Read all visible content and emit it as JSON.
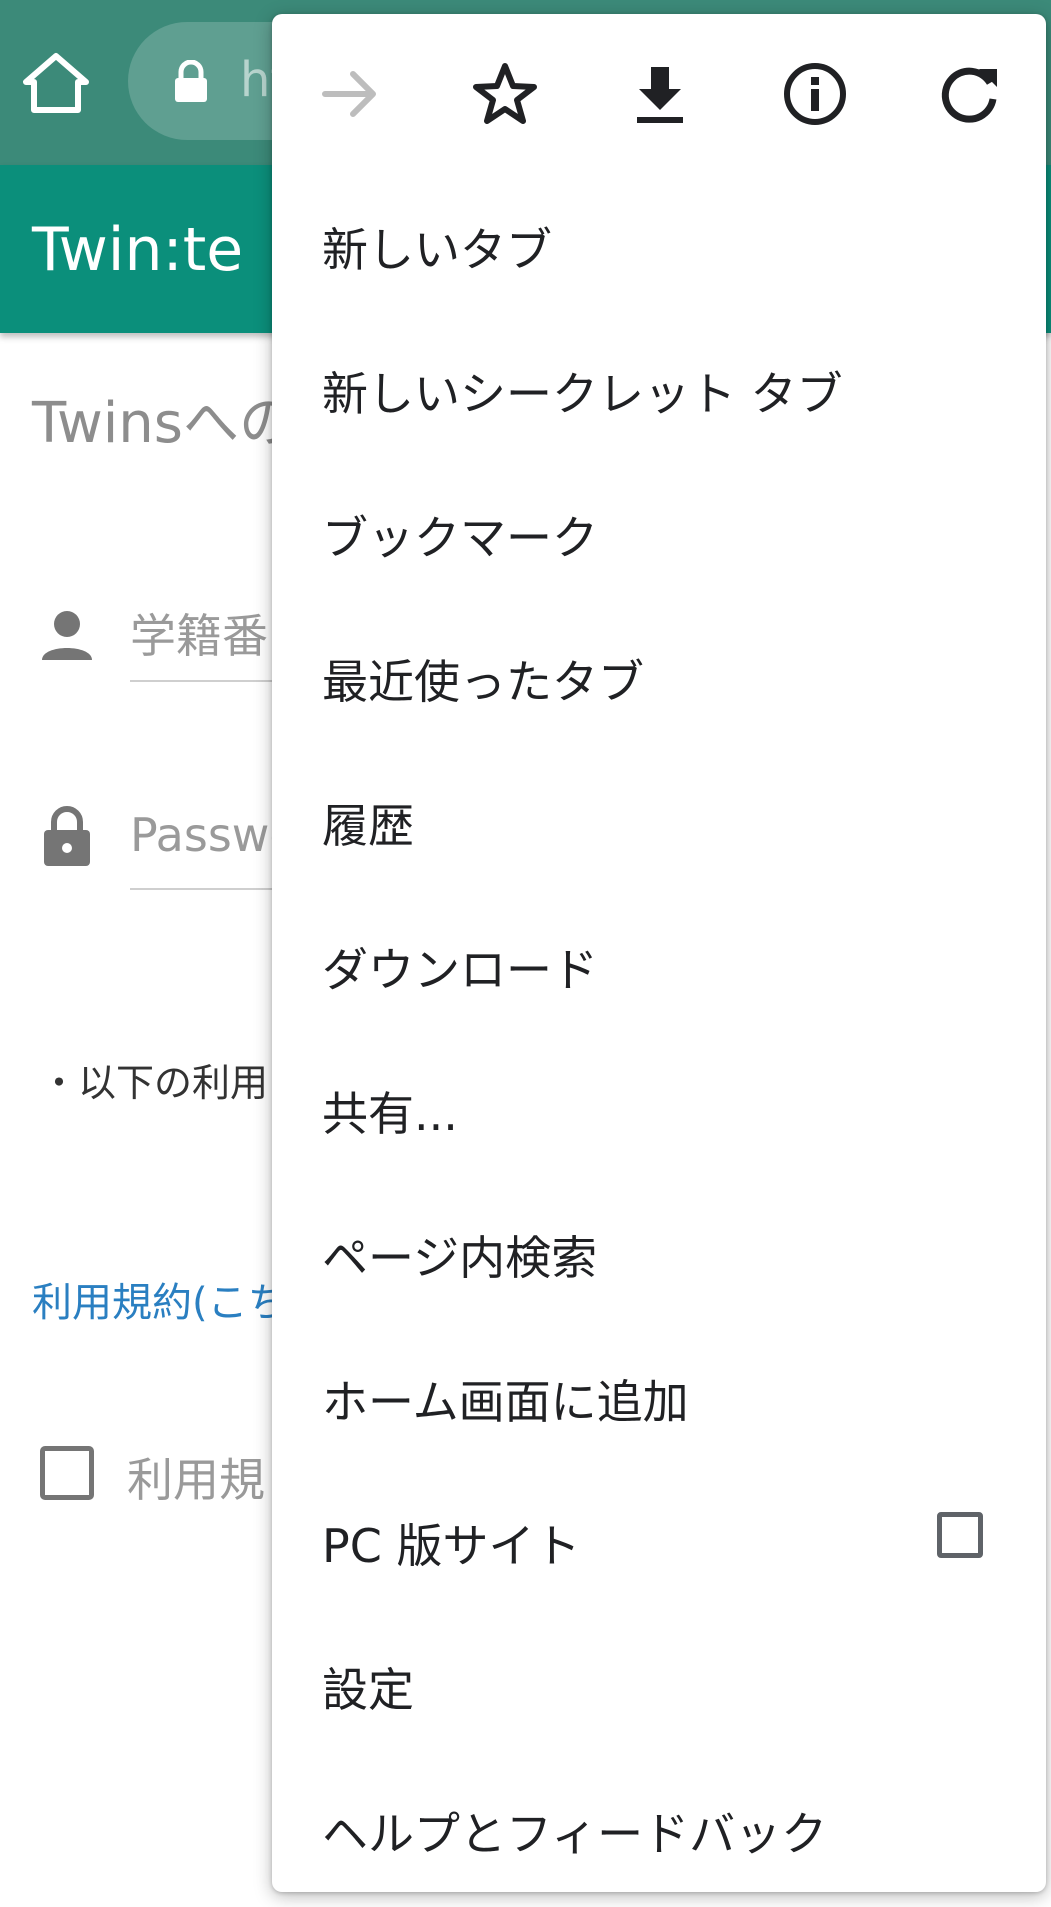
{
  "browser": {
    "url_partial": "ht"
  },
  "app": {
    "title": "Twin:te",
    "heading_partial": "Twinsへの",
    "student_id_placeholder": "学籍番",
    "password_placeholder": "Passwo",
    "terms_text_partial": "・以下の利用",
    "terms_link_partial": "利用規約(こち",
    "agree_label_partial": "利用規"
  },
  "menu": {
    "top_icons": [
      "forward-icon",
      "star-icon",
      "download-icon",
      "info-icon",
      "reload-icon"
    ],
    "items": [
      {
        "label": "新しいタブ"
      },
      {
        "label": "新しいシークレット タブ"
      },
      {
        "label": "ブックマーク"
      },
      {
        "label": "最近使ったタブ"
      },
      {
        "label": "履歴"
      },
      {
        "label": "ダウンロード"
      },
      {
        "label": "共有..."
      },
      {
        "label": "ページ内検索"
      },
      {
        "label": "ホーム画面に追加"
      },
      {
        "label": "PC 版サイト",
        "checked": false
      },
      {
        "label": "設定"
      },
      {
        "label": "ヘルプとフィードバック"
      }
    ]
  },
  "colors": {
    "chrome_bar": "#3c8a79",
    "app_bar": "#0b8f7b",
    "link": "#2a7fc1"
  }
}
